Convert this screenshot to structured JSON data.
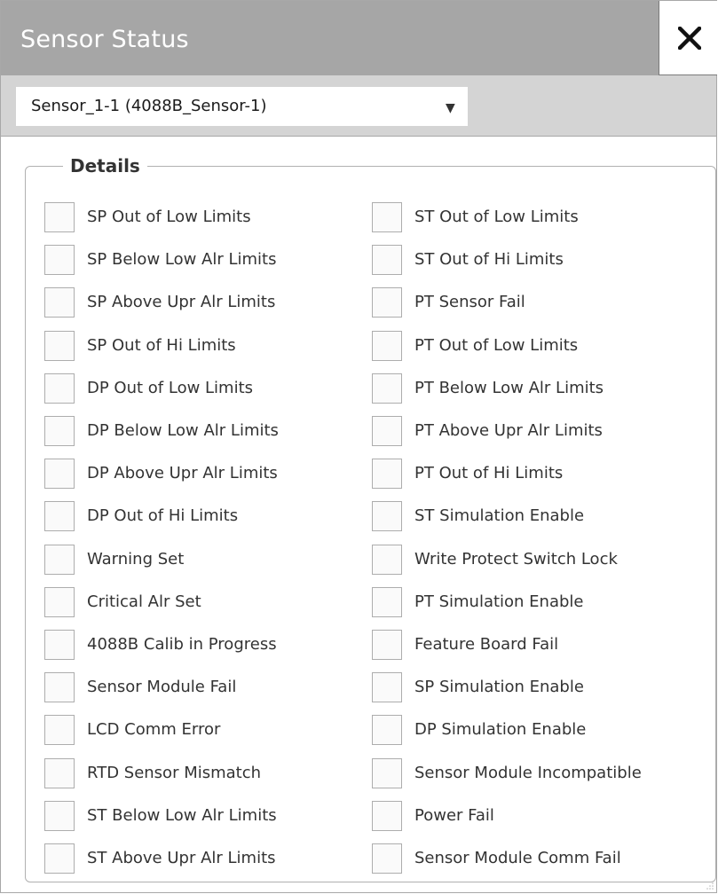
{
  "window": {
    "title": "Sensor Status"
  },
  "sensor_select": {
    "value": "Sensor_1-1 (4088B_Sensor-1)"
  },
  "details": {
    "legend": "Details",
    "left_items": [
      {
        "label": "SP Out of Low Limits",
        "checked": false
      },
      {
        "label": "SP Below Low Alr Limits",
        "checked": false
      },
      {
        "label": "SP Above Upr Alr Limits",
        "checked": false
      },
      {
        "label": "SP Out of Hi Limits",
        "checked": false
      },
      {
        "label": "DP Out of Low Limits",
        "checked": false
      },
      {
        "label": "DP Below Low Alr Limits",
        "checked": false
      },
      {
        "label": "DP Above Upr Alr Limits",
        "checked": false
      },
      {
        "label": "DP Out of Hi Limits",
        "checked": false
      },
      {
        "label": "Warning Set",
        "checked": false
      },
      {
        "label": "Critical Alr Set",
        "checked": false
      },
      {
        "label": "4088B Calib in Progress",
        "checked": false
      },
      {
        "label": "Sensor Module Fail",
        "checked": false
      },
      {
        "label": "LCD Comm Error",
        "checked": false
      },
      {
        "label": "RTD Sensor Mismatch",
        "checked": false
      },
      {
        "label": "ST Below Low Alr Limits",
        "checked": false
      },
      {
        "label": "ST Above Upr Alr Limits",
        "checked": false
      }
    ],
    "right_items": [
      {
        "label": "ST Out of Low Limits",
        "checked": false
      },
      {
        "label": "ST Out of Hi Limits",
        "checked": false
      },
      {
        "label": "PT Sensor Fail",
        "checked": false
      },
      {
        "label": "PT Out of Low Limits",
        "checked": false
      },
      {
        "label": "PT Below Low Alr Limits",
        "checked": false
      },
      {
        "label": "PT Above Upr Alr Limits",
        "checked": false
      },
      {
        "label": "PT Out of Hi Limits",
        "checked": false
      },
      {
        "label": "ST Simulation Enable",
        "checked": false
      },
      {
        "label": "Write Protect Switch Lock",
        "checked": false
      },
      {
        "label": "PT Simulation Enable",
        "checked": false
      },
      {
        "label": "Feature Board Fail",
        "checked": false
      },
      {
        "label": "SP Simulation Enable",
        "checked": false
      },
      {
        "label": "DP Simulation Enable",
        "checked": false
      },
      {
        "label": "Sensor Module Incompatible",
        "checked": false
      },
      {
        "label": "Power Fail",
        "checked": false
      },
      {
        "label": "Sensor Module Comm Fail",
        "checked": false
      }
    ]
  },
  "colors": {
    "titlebar": "#a6a6a6",
    "selectbar": "#d4d4d4",
    "title_text": "#ffffff",
    "label_text": "#333333",
    "checkbox_border": "#adadad"
  }
}
